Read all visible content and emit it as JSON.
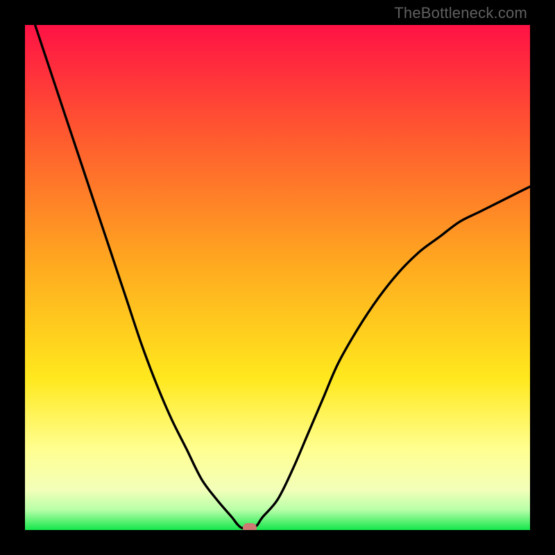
{
  "attribution": "TheBottleneck.com",
  "colors": {
    "frame": "#000000",
    "grad_top": "#ff1a4a",
    "grad_mid": "#ffd020",
    "grad_low": "#ffff8e",
    "grad_bottom": "#18e84e",
    "curve": "#000000",
    "marker": "#cc7a72"
  },
  "chart_data": {
    "type": "line",
    "title": "",
    "xlabel": "",
    "ylabel": "",
    "xlim": [
      0,
      100
    ],
    "ylim": [
      0,
      100
    ],
    "x": [
      2,
      5,
      8,
      11,
      14,
      17,
      20,
      23,
      26,
      29,
      32,
      35,
      38,
      41,
      42,
      43,
      45,
      46,
      47,
      50,
      53,
      56,
      59,
      62,
      66,
      70,
      74,
      78,
      82,
      86,
      90,
      94,
      98,
      100
    ],
    "values": [
      100,
      91,
      82,
      73,
      64,
      55,
      46,
      37,
      29,
      22,
      16,
      10,
      6,
      2.5,
      1.2,
      0.4,
      0.4,
      1.0,
      2.5,
      6,
      12,
      19,
      26,
      33,
      40,
      46,
      51,
      55,
      58,
      61,
      63,
      65,
      67,
      68
    ],
    "minimum_x": 44,
    "minimum_y": 0,
    "marker": {
      "x": 44.5,
      "y": 0.4
    },
    "flat_band_y": 0.4
  }
}
